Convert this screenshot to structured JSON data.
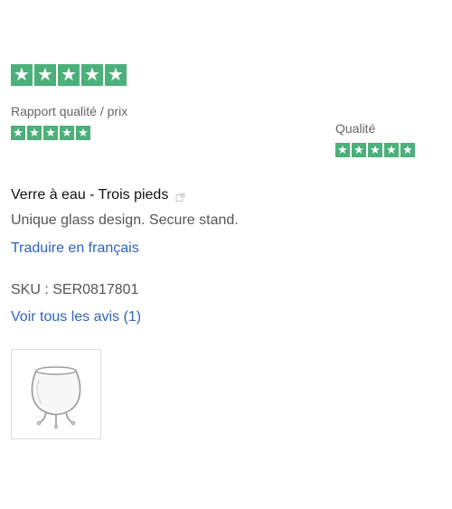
{
  "overall_rating": {
    "stars": 5,
    "star_glyph": "★",
    "color": "#4bb07a"
  },
  "ratings": [
    {
      "label": "Rapport qualité / prix",
      "stars": 5
    },
    {
      "label": "Qualité",
      "stars": 5
    }
  ],
  "review": {
    "title": "Verre à eau - Trois pieds",
    "external_icon": "external-link-icon",
    "body": "Unique glass design. Secure stand.",
    "translate_label": "Traduire en français",
    "sku": "SKU : SER0817801",
    "all_reviews_label": "Voir tous les avis (1)"
  },
  "product_image": {
    "icon": "glass-tripod-icon"
  }
}
